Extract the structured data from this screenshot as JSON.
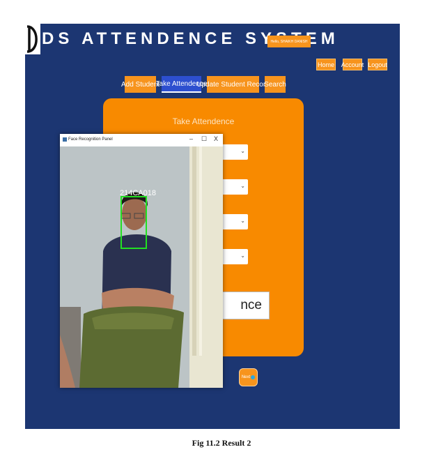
{
  "app": {
    "title": "DS ATTENDENCE SYSTEM",
    "hello": "Hello, SHAIKH DANISH"
  },
  "top_nav": {
    "home": "Home",
    "account": "Account",
    "logout": "Logout"
  },
  "nav_tabs": {
    "add_student": "Add Student",
    "take_attendence": "Take Attendence",
    "update_record": "Update Student Record",
    "search": "Search"
  },
  "panel": {
    "title": "Take Attendence",
    "big_text": "nce",
    "next": "Next"
  },
  "face_window": {
    "title": "Face Recognition Panel",
    "minimize": "–",
    "maximize": "☐",
    "close": "X",
    "detected_id": "214CA018"
  },
  "caption": "Fig 11.2 Result 2",
  "colors": {
    "background": "#1c3672",
    "accent": "#f7941d",
    "active_tab": "#2d4fcf",
    "detection_box": "#22e022"
  }
}
